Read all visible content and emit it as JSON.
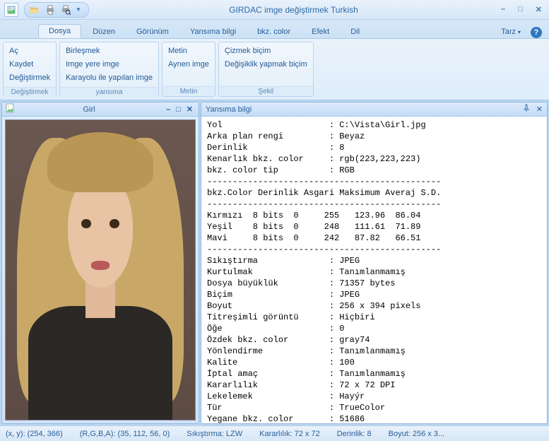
{
  "app": {
    "title": "GIRDAC imge değiştirmek Turkish"
  },
  "qat_icons": [
    "folder-open",
    "print",
    "print-preview"
  ],
  "tabs": [
    "Dosya",
    "Düzen",
    "Görünüm",
    "Yansıma bilgi",
    "bkz. color",
    "Efekt",
    "Dil"
  ],
  "active_tab": 0,
  "tarz_label": "Tarz",
  "ribbon_groups": [
    {
      "items": [
        "Aç",
        "Kaydet",
        "Değiştirmek"
      ],
      "label": "Değiştirmek"
    },
    {
      "items": [
        "Birleşmek",
        "Imge yere imge",
        "Karayolu ile yapılan imge"
      ],
      "label": "yansıma"
    },
    {
      "items": [
        "Metin",
        "Aynen imge"
      ],
      "label": "Metin"
    },
    {
      "items": [
        "Çizmek biçim",
        "Değişiklik yapmak biçim"
      ],
      "label": "Şekil"
    }
  ],
  "child_window": {
    "title": "Girl"
  },
  "info_panel": {
    "title": "Yansıma bilgi",
    "props1": [
      [
        "Yol",
        "C:\\Vista\\Girl.jpg"
      ],
      [
        "Arka plan rengi",
        "Beyaz"
      ],
      [
        "Derinlik",
        "8"
      ],
      [
        "Kenarlık bkz. color",
        "rgb(223,223,223)"
      ],
      [
        "bkz. color tip",
        "RGB"
      ]
    ],
    "stats_header": "bkz.Color Derinlik Asgari Maksimum Averaj S.D.",
    "stats": [
      [
        "Kırmızı",
        "8 bits",
        "0",
        "255",
        "123.96",
        "86.04"
      ],
      [
        "Yeşil",
        "8 bits",
        "0",
        "248",
        "111.61",
        "71.89"
      ],
      [
        "Mavi",
        "8 bits",
        "0",
        "242",
        "87.82",
        "66.51"
      ]
    ],
    "props2": [
      [
        "Sıkıştırma",
        "JPEG"
      ],
      [
        "Kurtulmak",
        "Tanımlanmamış"
      ],
      [
        "Dosya büyüklük",
        "71357 bytes"
      ],
      [
        "Biçim",
        "JPEG"
      ],
      [
        "Boyut",
        "256 x 394 pixels"
      ],
      [
        "Titreşimli görüntü",
        "Hiçbiri"
      ],
      [
        "Öğe",
        "0"
      ],
      [
        "Özdek bkz. color",
        "gray74"
      ],
      [
        "Yönlendirme",
        "Tanımlanmamış"
      ],
      [
        "Kalite",
        "100"
      ],
      [
        "İptal amaç",
        "Tanımlanmamış"
      ],
      [
        "Kararlılık",
        "72 x 72 DPI"
      ],
      [
        "Lekelemek",
        "Hayýr"
      ],
      [
        "Tür",
        "TrueColor"
      ],
      [
        "Yegane bkz. color",
        "51686"
      ]
    ]
  },
  "statusbar": {
    "xy": "(x, y): (254, 366)",
    "rgba": "(R,G,B,A): (35, 112, 56, 0)",
    "compression": "Sıkıştırma: LZW",
    "resolution": "Kararlılık: 72 x 72",
    "depth": "Derinlik: 8",
    "size": "Boyut: 256 x 3..."
  }
}
